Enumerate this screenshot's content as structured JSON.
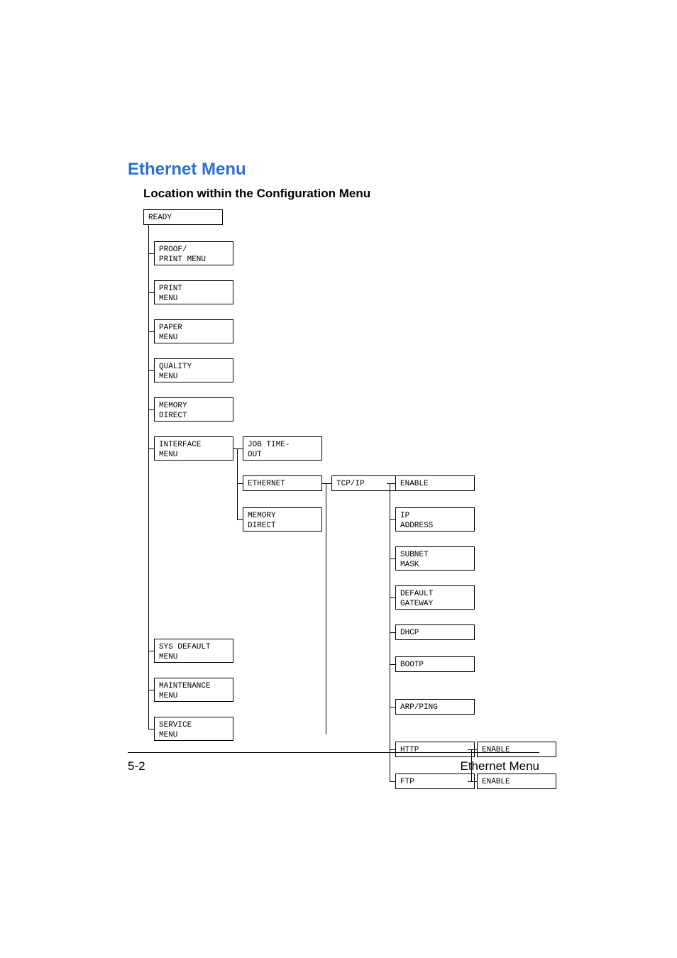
{
  "title": "Ethernet Menu",
  "subtitle": "Location within the Configuration Menu",
  "ready": "READY",
  "col1": {
    "proof": "PROOF/\nPRINT MENU",
    "print": "PRINT\nMENU",
    "paper": "PAPER\nMENU",
    "quality": "QUALITY\nMENU",
    "memory": "MEMORY\nDIRECT",
    "interface": "INTERFACE\nMENU",
    "sysdefault": "SYS DEFAULT\nMENU",
    "maintenance": "MAINTENANCE\nMENU",
    "service": "SERVICE\nMENU"
  },
  "col2": {
    "job": "JOB TIME-\nOUT",
    "ethernet": "ETHERNET",
    "memory": "MEMORY\nDIRECT"
  },
  "col3": {
    "tcpip": "TCP/IP"
  },
  "col4": {
    "enable": "ENABLE",
    "ip": "IP\nADDRESS",
    "subnet": "SUBNET\nMASK",
    "gateway": "DEFAULT\nGATEWAY",
    "dhcp": "DHCP",
    "bootp": "BOOTP",
    "arp": "ARP/PING",
    "http": "HTTP",
    "ftp": "FTP"
  },
  "col5": {
    "enable1": "ENABLE",
    "enable2": "ENABLE"
  },
  "footer": {
    "left": "5-2",
    "right": "Ethernet Menu"
  }
}
